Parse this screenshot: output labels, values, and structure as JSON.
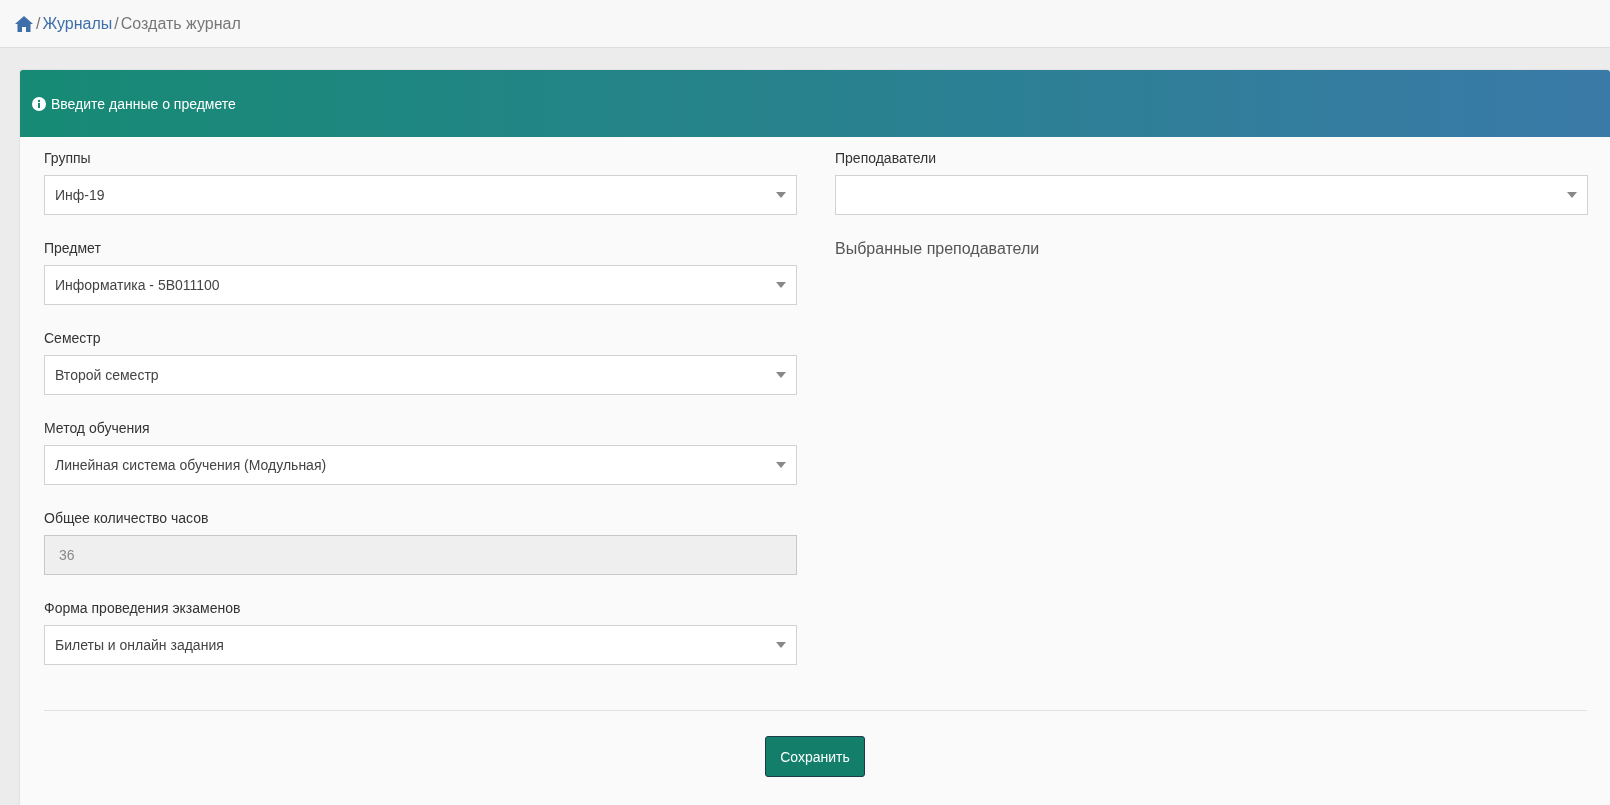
{
  "breadcrumb": {
    "items": [
      {
        "separator": "/",
        "label": "Журналы",
        "kind": "link"
      },
      {
        "separator": "/",
        "label": "Создать журнал",
        "kind": "current"
      }
    ]
  },
  "panel": {
    "title": "Введите данные о предмете",
    "left_fields": [
      {
        "label": "Группы",
        "kind": "select",
        "value": "Инф-19",
        "disabled": false
      },
      {
        "label": "Предмет",
        "kind": "select",
        "value": "Информатика - 5В011100",
        "disabled": false
      },
      {
        "label": "Семестр",
        "kind": "select",
        "value": "Второй семестр",
        "disabled": false
      },
      {
        "label": "Метод обучения",
        "kind": "select",
        "value": "Линейная система обучения (Модульная)",
        "disabled": false
      },
      {
        "label": "Общее количество часов",
        "kind": "input",
        "value": "36",
        "disabled": true
      },
      {
        "label": "Форма проведения экзаменов",
        "kind": "select",
        "value": "Билеты и онлайн задания",
        "disabled": false
      }
    ],
    "right_fields": [
      {
        "label": "Преподаватели",
        "kind": "select",
        "disabled": false
      }
    ],
    "selected_note": "Выбранные преподаватели",
    "save_button": "Сохранить"
  }
}
